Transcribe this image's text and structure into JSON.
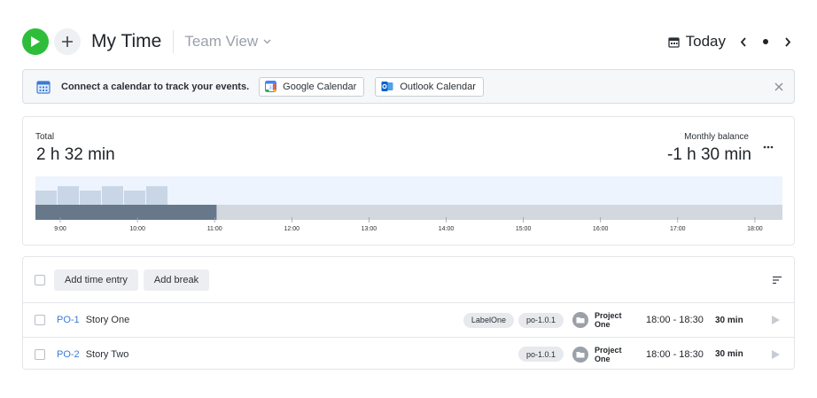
{
  "header": {
    "title": "My Time",
    "team_view": "Team View",
    "today": "Today"
  },
  "banner": {
    "message": "Connect a calendar to track your events.",
    "google_label": "Google Calendar",
    "outlook_label": "Outlook Calendar"
  },
  "summary": {
    "total_label": "Total",
    "total_value": "2 h 32 min",
    "balance_label": "Monthly balance",
    "balance_value": "-1 h 30 min"
  },
  "timeline": {
    "hours": [
      "9:00",
      "10:00",
      "11:00",
      "12:00",
      "13:00",
      "14:00",
      "15:00",
      "16:00",
      "17:00",
      "18:00"
    ],
    "tracked_until_fraction": 0.2425,
    "colors": {
      "tracked": "#66788a",
      "untracked": "#d3d7de",
      "activity": "#c9d6e6",
      "lane": "#eef4fd"
    }
  },
  "toolbar": {
    "add_entry_label": "Add time entry",
    "add_break_label": "Add break"
  },
  "entries": [
    {
      "key": "PO-1",
      "title": "Story One",
      "labels": [
        "LabelOne",
        "po-1.0.1"
      ],
      "project": "Project One",
      "time_range": "18:00  - 18:30",
      "duration": "30 min"
    },
    {
      "key": "PO-2",
      "title": "Story Two",
      "labels": [
        "po-1.0.1"
      ],
      "project": "Project One",
      "time_range": "18:00  - 18:30",
      "duration": "30 min"
    }
  ],
  "colors": {
    "accent_green": "#2ebd3a",
    "link_blue": "#3a7bd5"
  }
}
